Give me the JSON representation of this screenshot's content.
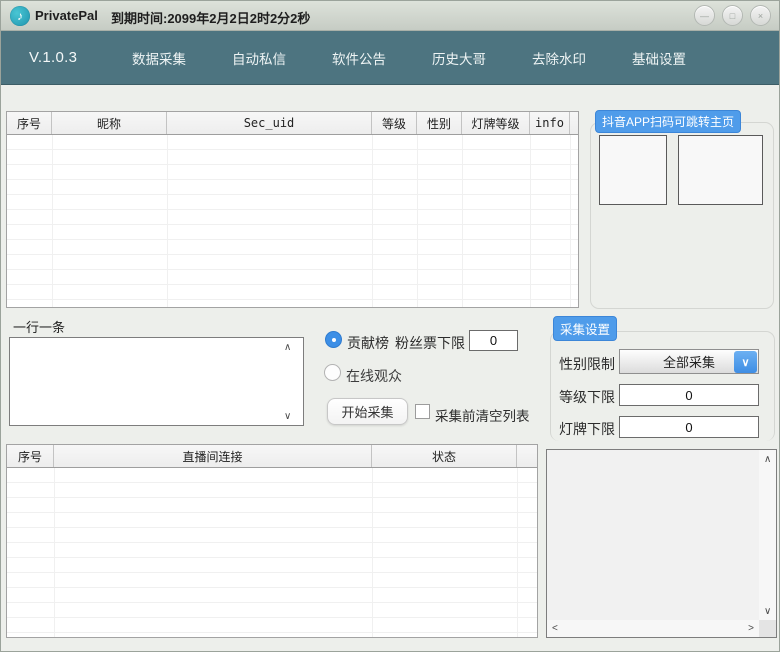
{
  "window": {
    "title": "PrivatePal",
    "expiry": "到期时间:2099年2月2日2时2分2秒"
  },
  "nav": {
    "version": "V.1.0.3",
    "items": [
      "数据采集",
      "自动私信",
      "软件公告",
      "历史大哥",
      "去除水印",
      "基础设置"
    ]
  },
  "users_table": {
    "columns": [
      "序号",
      "昵称",
      "Sec_uid",
      "等级",
      "性别",
      "灯牌等级",
      "info"
    ],
    "rows": []
  },
  "qr_panel": {
    "label": "抖音APP扫码可跳转主页"
  },
  "input_section": {
    "label": "一行一条",
    "textarea_value": ""
  },
  "collect_controls": {
    "radio_contribution_label": "贡献榜",
    "radio_online_label": "在线观众",
    "fans_ticket_label": "粉丝票下限",
    "fans_ticket_value": "0",
    "start_button_label": "开始采集",
    "clear_checkbox_label": "采集前清空列表"
  },
  "collect_settings": {
    "label": "采集设置",
    "gender_label": "性别限制",
    "gender_value": "全部采集",
    "level_label": "等级下限",
    "level_value": "0",
    "lamp_label": "灯牌下限",
    "lamp_value": "0"
  },
  "rooms_table": {
    "columns": [
      "序号",
      "直播间连接",
      "状态"
    ],
    "rows": []
  },
  "icons": {
    "app_logo": "♪",
    "minimize": "—",
    "maximize": "□",
    "close": "×",
    "up": "∧",
    "down": "∨",
    "left": "<",
    "right": ">",
    "chevron_down": "∨"
  },
  "colors": {
    "accent_blue": "#4f9cea",
    "nav_teal": "#4d7480",
    "radio_selected": "#3d8fe6"
  }
}
